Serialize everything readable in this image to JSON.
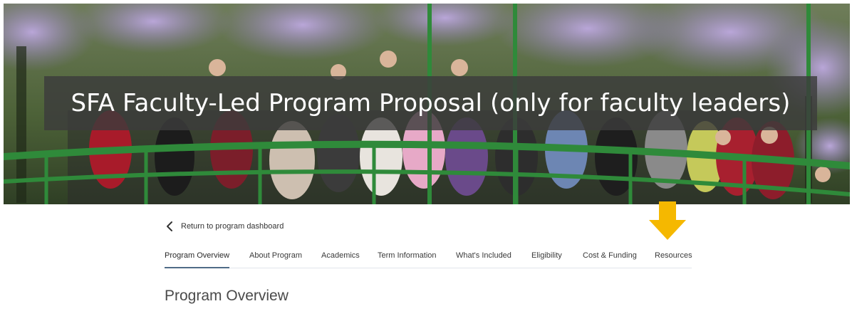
{
  "hero": {
    "title": "SFA Faculty-Led Program Proposal (only for faculty leaders)",
    "image": "group-photo-on-green-bridge-under-wisteria"
  },
  "nav": {
    "back_label": "Return to program dashboard",
    "back_icon": "chevron-left-icon"
  },
  "tabs": [
    {
      "label": "Program Overview",
      "active": true
    },
    {
      "label": "About Program",
      "active": false
    },
    {
      "label": "Academics",
      "active": false
    },
    {
      "label": "Term Information",
      "active": false
    },
    {
      "label": "What's Included",
      "active": false
    },
    {
      "label": "Eligibility",
      "active": false
    },
    {
      "label": "Cost & Funding",
      "active": false
    },
    {
      "label": "Resources",
      "active": false
    }
  ],
  "annotation": {
    "icon": "arrow-down-icon",
    "color": "#f5b800"
  },
  "main": {
    "section_title": "Program Overview"
  },
  "colors": {
    "active_tab_underline": "#4f6b87",
    "bridge_green": "#2f8a3a",
    "title_band": "#3c3c3c"
  }
}
